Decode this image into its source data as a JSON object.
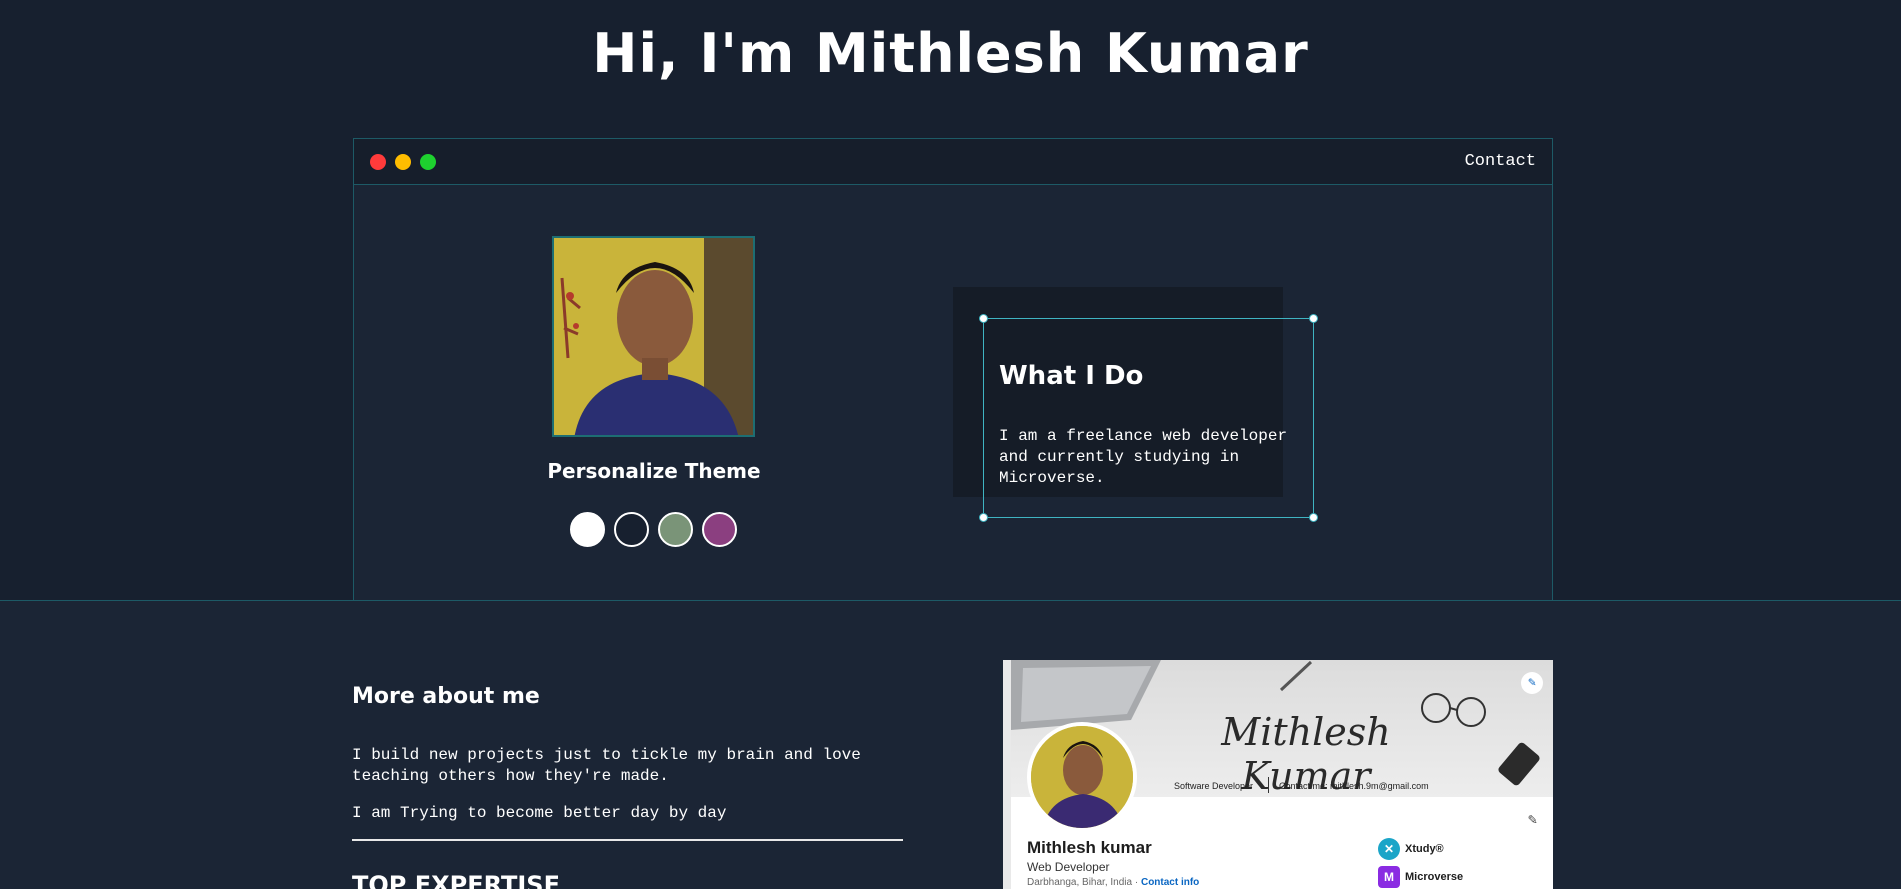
{
  "hero": {
    "title": "Hi, I'm Mithlesh Kumar"
  },
  "window": {
    "contact_label": "Contact"
  },
  "theme": {
    "title": "Personalize Theme",
    "swatches": [
      "#ffffff",
      "#17202f",
      "#7a9478",
      "#8b3f80"
    ]
  },
  "what_i_do": {
    "title": "What I Do",
    "text": "I am a freelance web developer and currently studying in Microverse."
  },
  "more_about": {
    "title": "More about me",
    "paragraph1": "I build new projects just to tickle my brain and love teaching others how they're made.",
    "paragraph2": "I am Trying to become better day by day"
  },
  "expertise": {
    "title": "TOP EXPERTISE"
  },
  "profile_card": {
    "banner_signature": "Mithlesh Kumar",
    "banner_role": "Software Developer",
    "banner_contact": "Contact me: mithlesh.9m@gmail.com",
    "name": "Mithlesh kumar",
    "role": "Web Developer",
    "location": "Darbhanga, Bihar, India ·",
    "contact_info": "Contact info",
    "orgs": [
      "Xtudy®",
      "Microverse"
    ]
  },
  "colors": {
    "background": "#17202f",
    "accent": "#3fb4c2",
    "close": "#ff3b3b",
    "minimize": "#ffbd00",
    "maximize": "#1ed12f"
  }
}
